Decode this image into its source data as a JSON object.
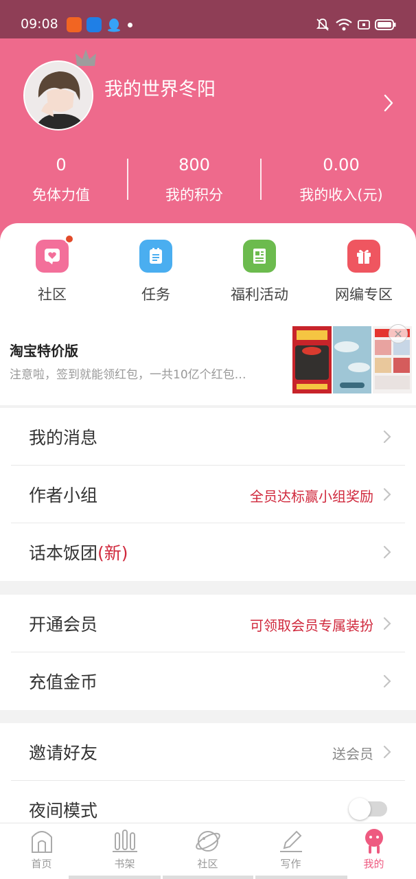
{
  "status_bar": {
    "time": "09:08"
  },
  "profile": {
    "username": "我的世界冬阳"
  },
  "stats": [
    {
      "value": "0",
      "label": "免体力值"
    },
    {
      "value": "800",
      "label": "我的积分"
    },
    {
      "value": "0.00",
      "label": "我的收入(元)"
    }
  ],
  "quick_actions": [
    {
      "label": "社区",
      "icon": "heart-chat-icon",
      "color": "#f36f9a"
    },
    {
      "label": "任务",
      "icon": "clipboard-icon",
      "color": "#4aaef0"
    },
    {
      "label": "福利活动",
      "icon": "news-icon",
      "color": "#6cbb4e"
    },
    {
      "label": "网编专区",
      "icon": "gift-icon",
      "color": "#ef5660"
    }
  ],
  "ad": {
    "title": "淘宝特价版",
    "subtitle": "注意啦，签到就能领红包，一共10亿个红包…"
  },
  "menu_section_1": [
    {
      "title": "我的消息",
      "right": ""
    },
    {
      "title": "作者小组",
      "right": "全员达标赢小组奖励"
    },
    {
      "title": "话本饭团",
      "title_highlight": "(新)",
      "right": ""
    }
  ],
  "menu_section_2": [
    {
      "title": "开通会员",
      "right": "可领取会员专属装扮"
    },
    {
      "title": "充值金币",
      "right": ""
    }
  ],
  "menu_section_3": [
    {
      "title": "邀请好友",
      "right": "送会员"
    },
    {
      "title": "夜间模式",
      "toggle": "off"
    }
  ],
  "bottom_nav": [
    {
      "label": "首页",
      "icon": "home-icon"
    },
    {
      "label": "书架",
      "icon": "bookshelf-icon"
    },
    {
      "label": "社区",
      "icon": "planet-icon"
    },
    {
      "label": "写作",
      "icon": "pen-icon"
    },
    {
      "label": "我的",
      "icon": "profile-icon",
      "active": true
    }
  ],
  "colors": {
    "header_bg": "#ee6a8c",
    "status_bg": "#8f3e56",
    "accent_red": "#d0283c",
    "active_tab": "#ee5a80"
  }
}
